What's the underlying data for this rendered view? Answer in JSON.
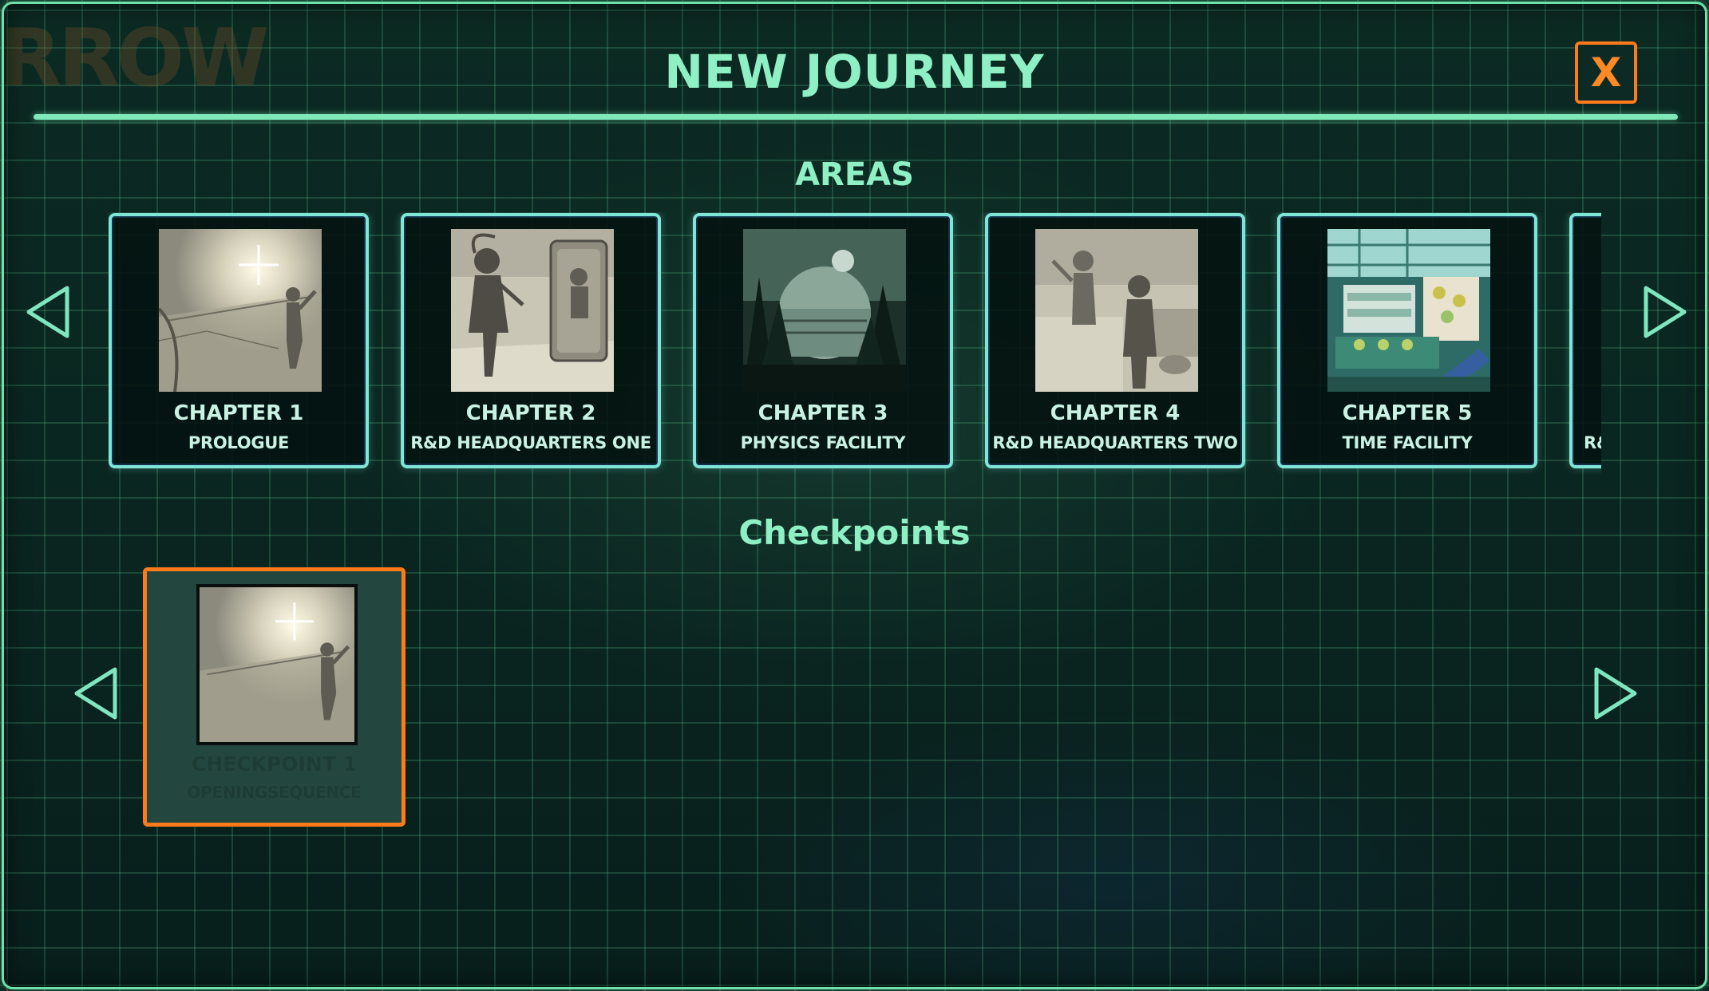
{
  "header": {
    "title": "NEW JOURNEY",
    "close_label": "X",
    "background_logo_fragment": "RROW"
  },
  "areas": {
    "heading": "AREAS",
    "cards": [
      {
        "title": "CHAPTER 1",
        "subtitle": "PROLOGUE",
        "thumbnail": "sketch-figure-light"
      },
      {
        "title": "CHAPTER 2",
        "subtitle": "R&D HEADQUARTERS ONE",
        "thumbnail": "sketch-figure-poster"
      },
      {
        "title": "CHAPTER 3",
        "subtitle": "PHYSICS FACILITY",
        "thumbnail": "forest-dome"
      },
      {
        "title": "CHAPTER 4",
        "subtitle": "R&D HEADQUARTERS TWO",
        "thumbnail": "sketch-lab-figures"
      },
      {
        "title": "CHAPTER 5",
        "subtitle": "TIME FACILITY",
        "thumbnail": "color-market-interior"
      },
      {
        "title": "",
        "subtitle": "R&",
        "thumbnail": "partial"
      }
    ]
  },
  "checkpoints": {
    "heading": "Checkpoints",
    "items": [
      {
        "title": "CHECKPOINT 1",
        "subtitle": "OPENINGSEQUENCE",
        "thumbnail": "sketch-figure-light"
      }
    ]
  },
  "icons": {
    "prev": "triangle-left-icon",
    "next": "triangle-right-icon"
  },
  "colors": {
    "accent": "#8ef0c4",
    "frame": "#6fe0ac",
    "selected": "#ff7a1a",
    "card_border": "#7fe6d6",
    "grid": "#2f7a5a"
  }
}
